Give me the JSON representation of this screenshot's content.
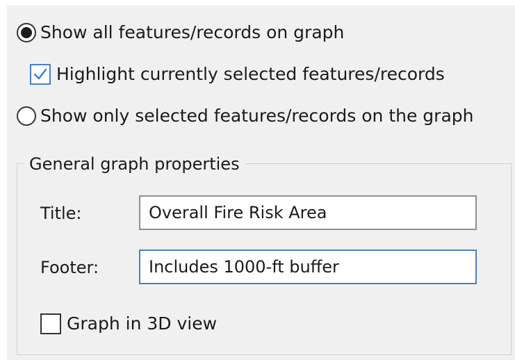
{
  "display_options": {
    "show_all": {
      "label": "Show all features/records on graph",
      "selected": true
    },
    "highlight_selected": {
      "label": "Highlight currently selected features/records",
      "checked": true
    },
    "show_only_selected": {
      "label": "Show only selected features/records on the graph",
      "selected": false
    }
  },
  "general_properties": {
    "group_title": "General graph properties",
    "title_label": "Title:",
    "title_value": "Overall Fire Risk Area",
    "footer_label": "Footer:",
    "footer_value": "Includes 1000-ft buffer",
    "graph_3d": {
      "label": "Graph in 3D view",
      "checked": false
    }
  },
  "colors": {
    "panel_background": "#f0f0f0",
    "accent": "#4a7fc1"
  }
}
